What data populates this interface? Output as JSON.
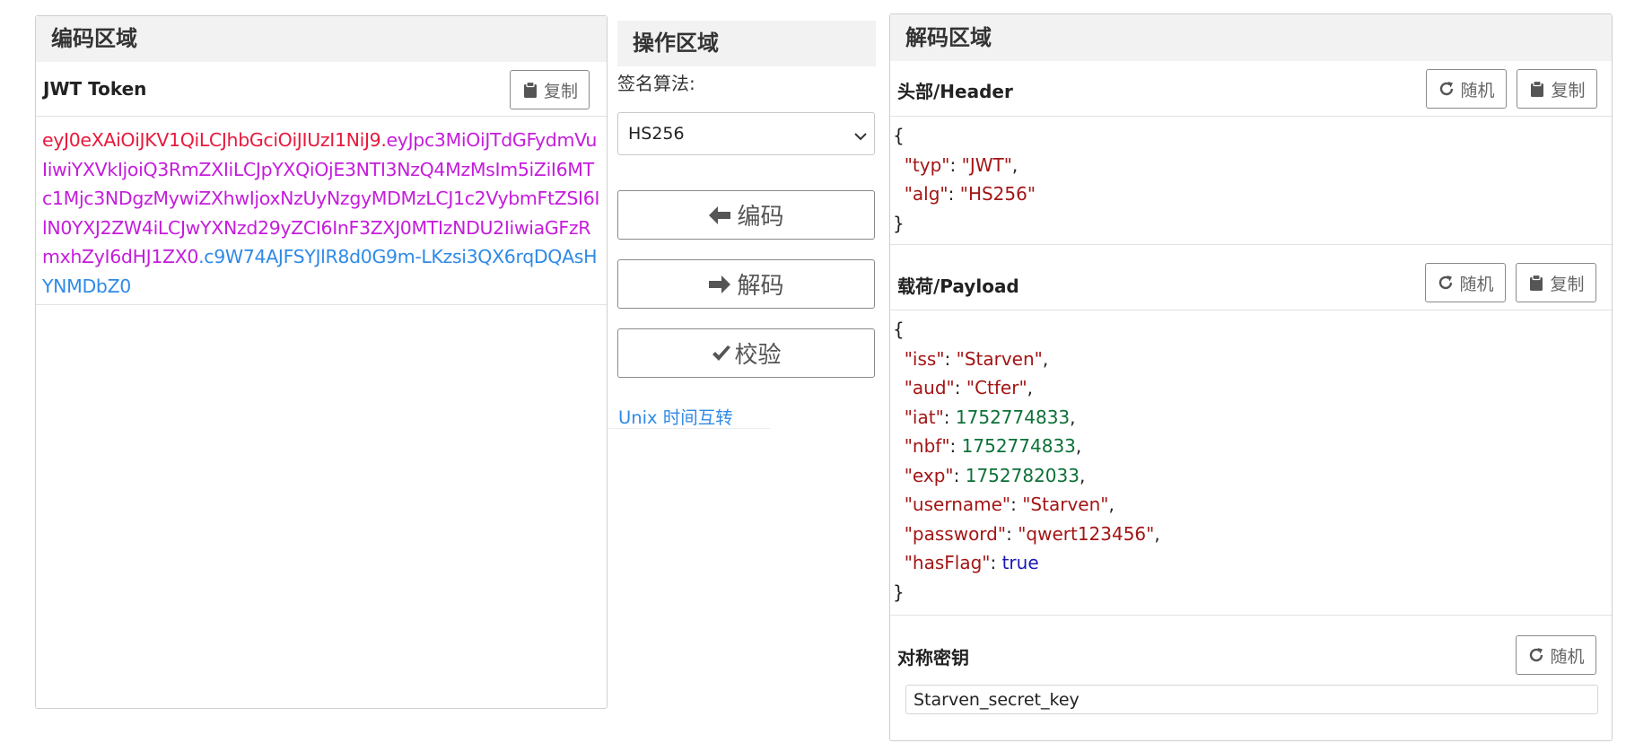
{
  "encode_panel": {
    "title": "编码区域",
    "jwt_label": "JWT Token",
    "copy_label": "复制",
    "token": {
      "header": "eyJ0eXAiOiJKV1QiLCJhbGciOiJIUzI1NiJ9",
      "payload": "eyJpc3MiOiJTdGFydmVuIiwiYXVkIjoiQ3RmZXIiLCJpYXQiOjE3NTI3NzQ4MzMsIm5iZiI6MTc1Mjc3NDgzMywiZXhwIjoxNzUyNzgyMDMzLCJ1c2VybmFtZSI6IlN0YXJ2ZW4iLCJwYXNzd29yZCI6InF3ZXJ0MTIzNDU2IiwiaGFzRmxhZyI6dHJ1ZX0",
      "signature": "c9W74AJFSYJlR8d0G9m-LKzsi3QX6rqDQAsHYNMDbZ0"
    }
  },
  "operate_panel": {
    "title": "操作区域",
    "algorithm_label": "签名算法:",
    "algorithm_value": "HS256",
    "encode_label": "编码",
    "decode_label": "解码",
    "verify_label": "校验",
    "unix_link": "Unix 时间互转"
  },
  "decode_panel": {
    "title": "解码区域",
    "header_label": "头部/Header",
    "payload_label": "载荷/Payload",
    "secret_label": "对称密钥",
    "random_label": "随机",
    "copy_label": "复制",
    "header_json": {
      "typ": "JWT",
      "alg": "HS256"
    },
    "payload_json": {
      "iss": "Starven",
      "aud": "Ctfer",
      "iat": 1752774833,
      "nbf": 1752774833,
      "exp": 1752782033,
      "username": "Starven",
      "password": "qwert123456",
      "hasFlag": "true"
    },
    "secret_value": "Starven_secret_key"
  },
  "colors": {
    "header": "#e8193c",
    "payload": "#c41ddb",
    "signature": "#2f8ae6",
    "link": "#2f8ae6"
  },
  "icons": {
    "copy": "clipboard-icon",
    "random": "refresh-icon",
    "encode": "arrow-left-icon",
    "decode": "arrow-right-icon",
    "verify": "check-icon"
  }
}
